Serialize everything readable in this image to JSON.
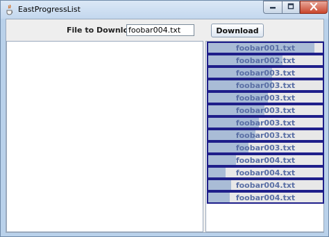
{
  "window": {
    "title": "EastProgressList",
    "icon": "java-cup-icon",
    "controls": [
      "minimize-icon",
      "maximize-icon",
      "close-icon"
    ],
    "close_color": "#c9452c"
  },
  "form": {
    "file_label": "File to Download:",
    "file_value": "foobar004.txt",
    "download_label": "Download"
  },
  "downloads": {
    "bar_border_color": "#1e1e8a",
    "fill_color": "#a9bcd6",
    "items": [
      {
        "label": "foobar001.txt",
        "progress": 0.93
      },
      {
        "label": "foobar002.txt",
        "progress": 0.65
      },
      {
        "label": "foobar003.txt",
        "progress": 0.56
      },
      {
        "label": "foobar003.txt",
        "progress": 0.56
      },
      {
        "label": "foobar003.txt",
        "progress": 0.52
      },
      {
        "label": "foobar003.txt",
        "progress": 0.49
      },
      {
        "label": "foobar003.txt",
        "progress": 0.44
      },
      {
        "label": "foobar003.txt",
        "progress": 0.41
      },
      {
        "label": "foobar003.txt",
        "progress": 0.35
      },
      {
        "label": "foobar004.txt",
        "progress": 0.24
      },
      {
        "label": "foobar004.txt",
        "progress": 0.15
      },
      {
        "label": "foobar004.txt",
        "progress": 0.2
      },
      {
        "label": "foobar004.txt",
        "progress": 0.19
      }
    ]
  }
}
